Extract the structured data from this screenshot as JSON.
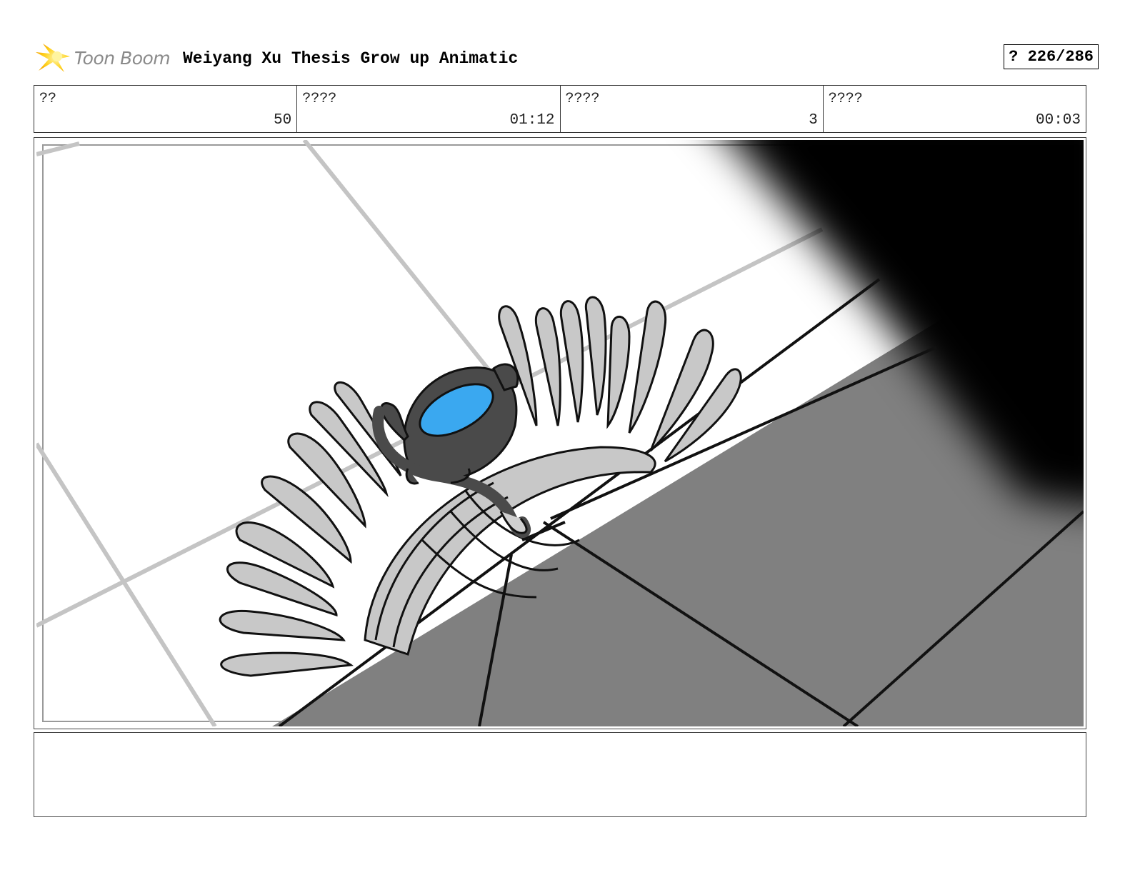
{
  "header": {
    "logo_text": "Toon Boom",
    "project_title": "Weiyang Xu Thesis Grow up Animatic",
    "page_counter": "? 226/286"
  },
  "info": [
    {
      "label": "??",
      "value": "50"
    },
    {
      "label": "????",
      "value": "01:12"
    },
    {
      "label": "????",
      "value": "3"
    },
    {
      "label": "????",
      "value": "00:03"
    }
  ],
  "panel": {
    "accent_color": "#3aa8f0",
    "floor_shadow_color": "#808080",
    "dark_corner_color": "#000000",
    "grass_fill_color": "#c8c8c8"
  },
  "notes": {
    "text": ""
  }
}
